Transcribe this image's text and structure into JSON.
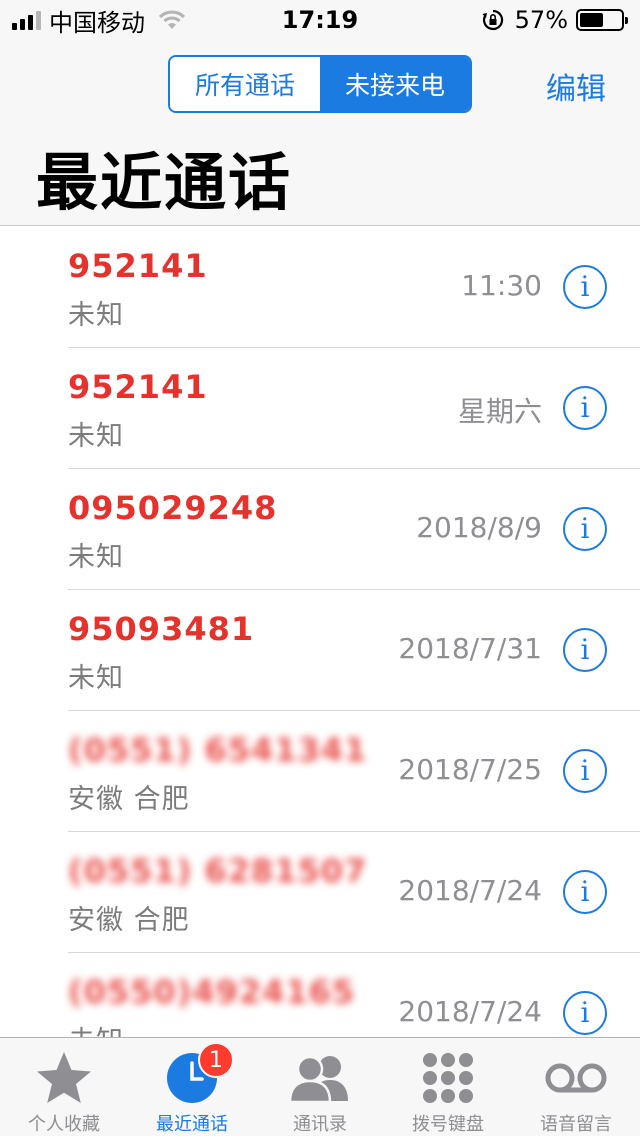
{
  "status_bar": {
    "carrier": "中国移动",
    "time": "17:19",
    "battery_percent": "57%",
    "battery_level": 0.57,
    "icons": [
      "signal-icon",
      "wifi-icon",
      "rotation-lock-icon",
      "battery-icon"
    ]
  },
  "header": {
    "segments": [
      {
        "label": "所有通话",
        "active": false
      },
      {
        "label": "未接来电",
        "active": true
      }
    ],
    "edit_label": "编辑",
    "title": "最近通话"
  },
  "calls": [
    {
      "caller": "952141",
      "location": "未知",
      "time": "11:30"
    },
    {
      "caller": "952141",
      "location": "未知",
      "time": "星期六"
    },
    {
      "caller": "095029248",
      "location": "未知",
      "time": "2018/8/9"
    },
    {
      "caller": "95093481",
      "location": "未知",
      "time": "2018/7/31"
    },
    {
      "caller": "(0551) 6541341",
      "location": "安徽 合肥",
      "time": "2018/7/25"
    },
    {
      "caller": "(0551) 6281507",
      "location": "安徽 合肥",
      "time": "2018/7/24"
    },
    {
      "caller": "(0550)4924165",
      "location": "未知",
      "time": "2018/7/24"
    }
  ],
  "tab_bar": {
    "tabs": [
      {
        "label": "个人收藏",
        "icon": "star-icon"
      },
      {
        "label": "最近通话",
        "icon": "clock-icon",
        "badge": "1",
        "active": true
      },
      {
        "label": "通讯录",
        "icon": "contacts-icon"
      },
      {
        "label": "拨号键盘",
        "icon": "keypad-icon"
      },
      {
        "label": "语音留言",
        "icon": "voicemail-icon"
      }
    ]
  },
  "colors": {
    "accent": "#1c7be0",
    "missed_call": "#e5322c",
    "secondary_text": "#8e8e93",
    "badge": "#ff3b30"
  }
}
